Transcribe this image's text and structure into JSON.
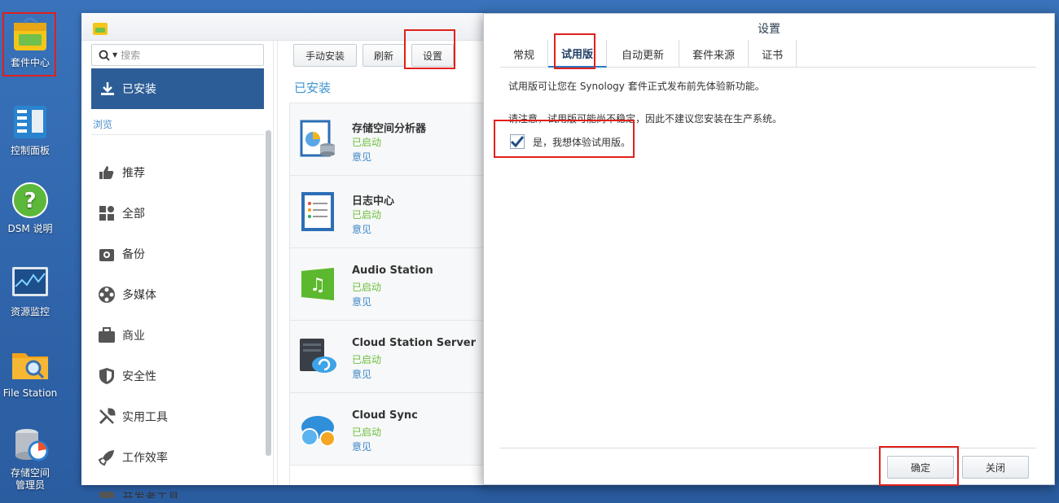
{
  "desktop": {
    "icons": [
      {
        "label": "套件中心"
      },
      {
        "label": "控制面板"
      },
      {
        "label": "DSM 说明"
      },
      {
        "label": "资源监控"
      },
      {
        "label": "File Station"
      },
      {
        "label": "存储空间\n管理员"
      }
    ]
  },
  "package_center": {
    "search_placeholder": "搜索",
    "nav_installed": "已安装",
    "browse_label": "浏览",
    "nav_items": [
      {
        "label": "推荐"
      },
      {
        "label": "全部"
      },
      {
        "label": "备份"
      },
      {
        "label": "多媒体"
      },
      {
        "label": "商业"
      },
      {
        "label": "安全性"
      },
      {
        "label": "实用工具"
      },
      {
        "label": "工作效率"
      },
      {
        "label": "开发者工具"
      }
    ],
    "toolbar": {
      "manual_install": "手动安装",
      "refresh": "刷新",
      "settings": "设置"
    },
    "section_title": "已安装",
    "packages": [
      {
        "name": "存储空间分析器",
        "status": "已启动",
        "feedback": "意见"
      },
      {
        "name": "日志中心",
        "status": "已启动",
        "feedback": "意见"
      },
      {
        "name": "Audio Station",
        "status": "已启动",
        "feedback": "意见"
      },
      {
        "name": "Cloud Station Server",
        "status": "已启动",
        "feedback": "意见"
      },
      {
        "name": "Cloud Sync",
        "status": "已启动",
        "feedback": "意见"
      }
    ]
  },
  "settings_dialog": {
    "title": "设置",
    "tabs": [
      "常规",
      "试用版",
      "自动更新",
      "套件来源",
      "证书"
    ],
    "active_tab": "试用版",
    "description": "试用版可让您在 Synology 套件正式发布前先体验新功能。",
    "warning": "请注意，试用版可能尚不稳定，因此不建议您安装在生产系统。",
    "checkbox_label": "是，我想体验试用版。",
    "checkbox_checked": true,
    "ok_button": "确定",
    "close_button": "关闭"
  },
  "colors": {
    "desktop_bg": "#3368b0",
    "highlight_box": "#e0201c",
    "nav_active_bg": "#2c5d96",
    "status_green": "#6cbf3c",
    "link_blue": "#3d86c6"
  }
}
